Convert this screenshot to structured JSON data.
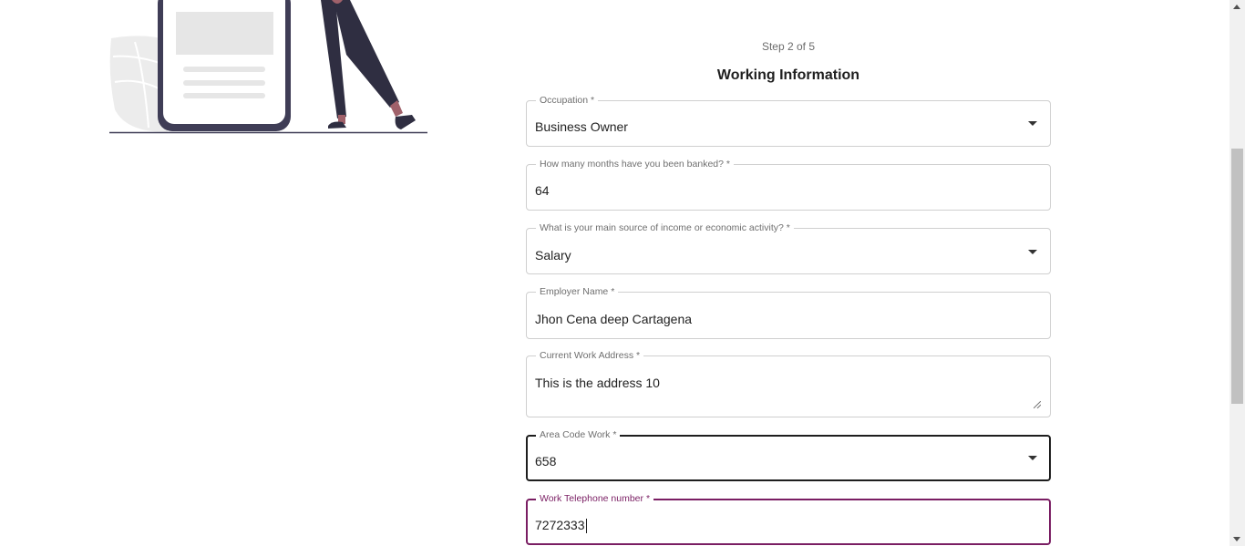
{
  "header": {
    "step": "Step 2 of 5",
    "title": "Working Information"
  },
  "fields": {
    "occupation": {
      "label": "Occupation *",
      "value": "Business Owner",
      "type": "select"
    },
    "months_banked": {
      "label": "How many months have you been banked? *",
      "value": "64",
      "type": "text"
    },
    "income_source": {
      "label": "What is your main source of income or economic activity? *",
      "value": "Salary",
      "type": "select"
    },
    "employer_name": {
      "label": "Employer Name *",
      "value": "Jhon Cena deep Cartagena",
      "type": "text"
    },
    "work_address": {
      "label": "Current Work Address *",
      "value": "This is the address 10",
      "type": "textarea"
    },
    "area_code": {
      "label": "Area Code Work *",
      "value": "658",
      "type": "select"
    },
    "work_phone": {
      "label_text": "Work Telephone number ",
      "required_mark": "*",
      "value": "7272333",
      "type": "text"
    }
  },
  "colors": {
    "focus_accent": "#7a1e63",
    "illustration_dark": "#3f3d56",
    "illustration_skin": "#a0616a"
  },
  "icons": {
    "select_caret": "chevron-down-icon",
    "scroll_up": "scroll-up-icon",
    "scroll_down": "scroll-down-icon"
  }
}
